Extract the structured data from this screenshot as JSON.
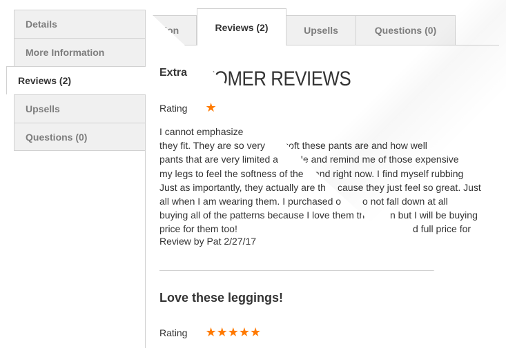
{
  "back": {
    "tabs": [
      {
        "label": "ation"
      },
      {
        "label": "Reviews (2)"
      },
      {
        "label": "Upsells"
      },
      {
        "label": "Questions (0)"
      }
    ],
    "heading": "USTOMER REVIEWS",
    "body_lines": [
      "",
      "ow very soft these pants are and how well",
      "ble and remind me of those expensive",
      "and right now. I find myself rubbing",
      "cause they just feel so great. Just",
      "o not fall down at all",
      "n but I will be buying",
      "d full price for"
    ]
  },
  "front": {
    "tabs": [
      {
        "label": "Details"
      },
      {
        "label": "More Information"
      },
      {
        "label": "Reviews (2)"
      },
      {
        "label": "Upsells"
      },
      {
        "label": "Questions (0)"
      }
    ],
    "review1": {
      "title": "Extra",
      "rating_label": "Rating",
      "stars": "★",
      "body_lines": [
        "I cannot emphasize",
        "they fit. They are so very",
        "pants that are very limited a",
        "my legs to feel the softness of the",
        "Just as importantly, they actually are th",
        "all when I am wearing them. I purchased o",
        "buying all of the patterns because I love them th",
        "price for them too!"
      ],
      "meta": "Review by Pat 2/27/17"
    },
    "review2": {
      "title": "Love these leggings!",
      "rating_label": "Rating",
      "stars": "★★★★★"
    }
  },
  "colors": {
    "star": "#ff7a00",
    "tab_bg": "#f0f0f0",
    "border": "#d1d1d1"
  }
}
